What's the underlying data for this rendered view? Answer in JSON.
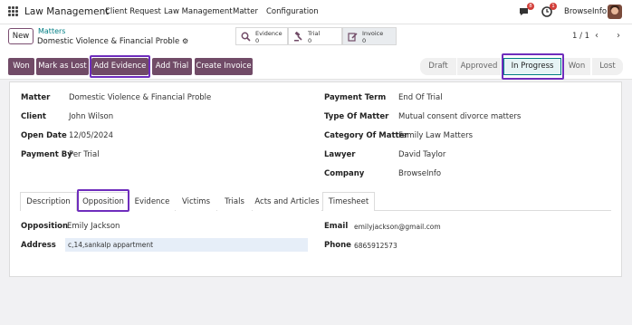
{
  "topbar": {
    "brand": "Law Management",
    "menu": [
      "Client Request",
      "Law Management",
      "Matter",
      "Configuration"
    ],
    "chat_badge": "8",
    "activity_badge": "1",
    "company": "BrowseInfo"
  },
  "control": {
    "new_label": "New",
    "breadcrumb_parent": "Matters",
    "breadcrumb_current": "Domestic Violence & Financial Proble",
    "smart_buttons": [
      {
        "label": "Evidence",
        "count": "0"
      },
      {
        "label": "Trial",
        "count": "0"
      },
      {
        "label": "Invoice",
        "count": "0"
      }
    ],
    "pager": "1 / 1"
  },
  "status": {
    "buttons": [
      "Won",
      "Mark as Lost",
      "Add Evidence",
      "Add Trial",
      "Create Invoice"
    ],
    "stages": [
      "Draft",
      "Approved",
      "In Progress",
      "Won",
      "Lost"
    ],
    "current_stage": "In Progress"
  },
  "form": {
    "left": [
      {
        "label": "Matter",
        "value": "Domestic Violence & Financial Proble"
      },
      {
        "label": "Client",
        "value": "John Wilson"
      },
      {
        "label": "Open Date",
        "value": "12/05/2024"
      },
      {
        "label": "Payment By",
        "value": "Per Trial"
      }
    ],
    "right": [
      {
        "label": "Payment Term",
        "value": "End Of Trial"
      },
      {
        "label": "Type Of Matter",
        "value": "Mutual consent divorce matters"
      },
      {
        "label": "Category Of Matter",
        "value": "Family Law Matters"
      },
      {
        "label": "Lawyer",
        "value": "David Taylor"
      },
      {
        "label": "Company",
        "value": "BrowseInfo"
      }
    ]
  },
  "tabs": [
    "Description",
    "Opposition",
    "Evidence",
    "Victims",
    "Trials",
    "Acts and Articles",
    "Timesheet"
  ],
  "active_tab": "Opposition",
  "opposition": {
    "opposition_label": "Opposition",
    "opposition_value": "Emily Jackson",
    "address_label": "Address",
    "address_value": "c,14,sankalp appartment",
    "email_label": "Email",
    "email_value": "emilyjackson@gmail.com",
    "phone_label": "Phone",
    "phone_value": "6865912573"
  },
  "colors": {
    "brand": "#714b67",
    "accent": "#017e84",
    "highlight": "#6f2dbd",
    "badge": "#d23f3a"
  }
}
